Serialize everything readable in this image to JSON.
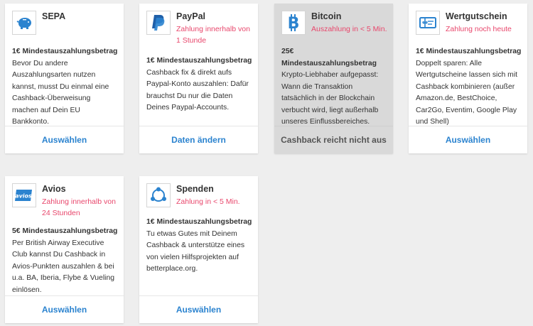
{
  "cards": [
    {
      "title": "SEPA",
      "subtitle": "",
      "minimum": "1€ Mindestauszahlungsbetrag",
      "description": "Bevor Du andere Auszahlungsarten nutzen kannst, musst Du einmal eine Cashback-Überweisung machen auf Dein EU Bankkonto.",
      "action": "Auswählen",
      "icon": "piggy-bank-icon"
    },
    {
      "title": "PayPal",
      "subtitle": "Zahlung innerhalb von 1 Stunde",
      "minimum": "1€ Mindestauszahlungsbetrag",
      "description": "Cashback fix & direkt aufs Paypal-Konto auszahlen: Dafür brauchst Du nur die Daten Deines Paypal-Accounts.",
      "action": "Daten ändern",
      "icon": "paypal-icon"
    },
    {
      "title": "Bitcoin",
      "subtitle": "Auszahlung in < 5 Min.",
      "minimum": "25€ Mindestauszahlungsbetrag",
      "description": "Krypto-Liebhaber aufgepasst: Wann die Transaktion tatsächlich in der Blockchain verbucht wird, liegt außerhalb unseres Einflussbereiches.",
      "action": "Cashback reicht nicht aus",
      "icon": "bitcoin-icon"
    },
    {
      "title": "Wertgutschein",
      "subtitle": "Zahlung noch heute",
      "minimum": "1€ Mindestauszahlungsbetrag",
      "description": "Doppelt sparen: Alle Wertgutscheine lassen sich mit Cashback kombinieren (außer Amazon.de, BestChoice, Car2Go, Eventim, Google Play und Shell)",
      "action": "Auswählen",
      "icon": "gift-voucher-icon"
    },
    {
      "title": "Avios",
      "subtitle": "Zahlung innerhalb von 24 Stunden",
      "minimum": "5€ Mindestauszahlungsbetrag",
      "description": "Per British Airway Executive Club kannst Du Cashback in Avios-Punkten auszahlen & bei u.a. BA, Iberia, Flybe & Vueling einlösen.",
      "action": "Auswählen",
      "icon": "avios-logo-icon",
      "logo_text": "avios"
    },
    {
      "title": "Spenden",
      "subtitle": "Zahlung in < 5 Min.",
      "minimum": "1€ Mindestauszahlungsbetrag",
      "description": "Tu etwas Gutes mit Deinem Cashback & unterstütze eines von vielen Hilfsprojekten auf betterplace.org.",
      "action": "Auswählen",
      "icon": "donation-icon"
    }
  ],
  "colors": {
    "accent_blue": "#2b83cf",
    "highlight_pink": "#e8476c",
    "page_bg": "#eeeeee",
    "disabled_card_bg": "#d9d9d9"
  }
}
